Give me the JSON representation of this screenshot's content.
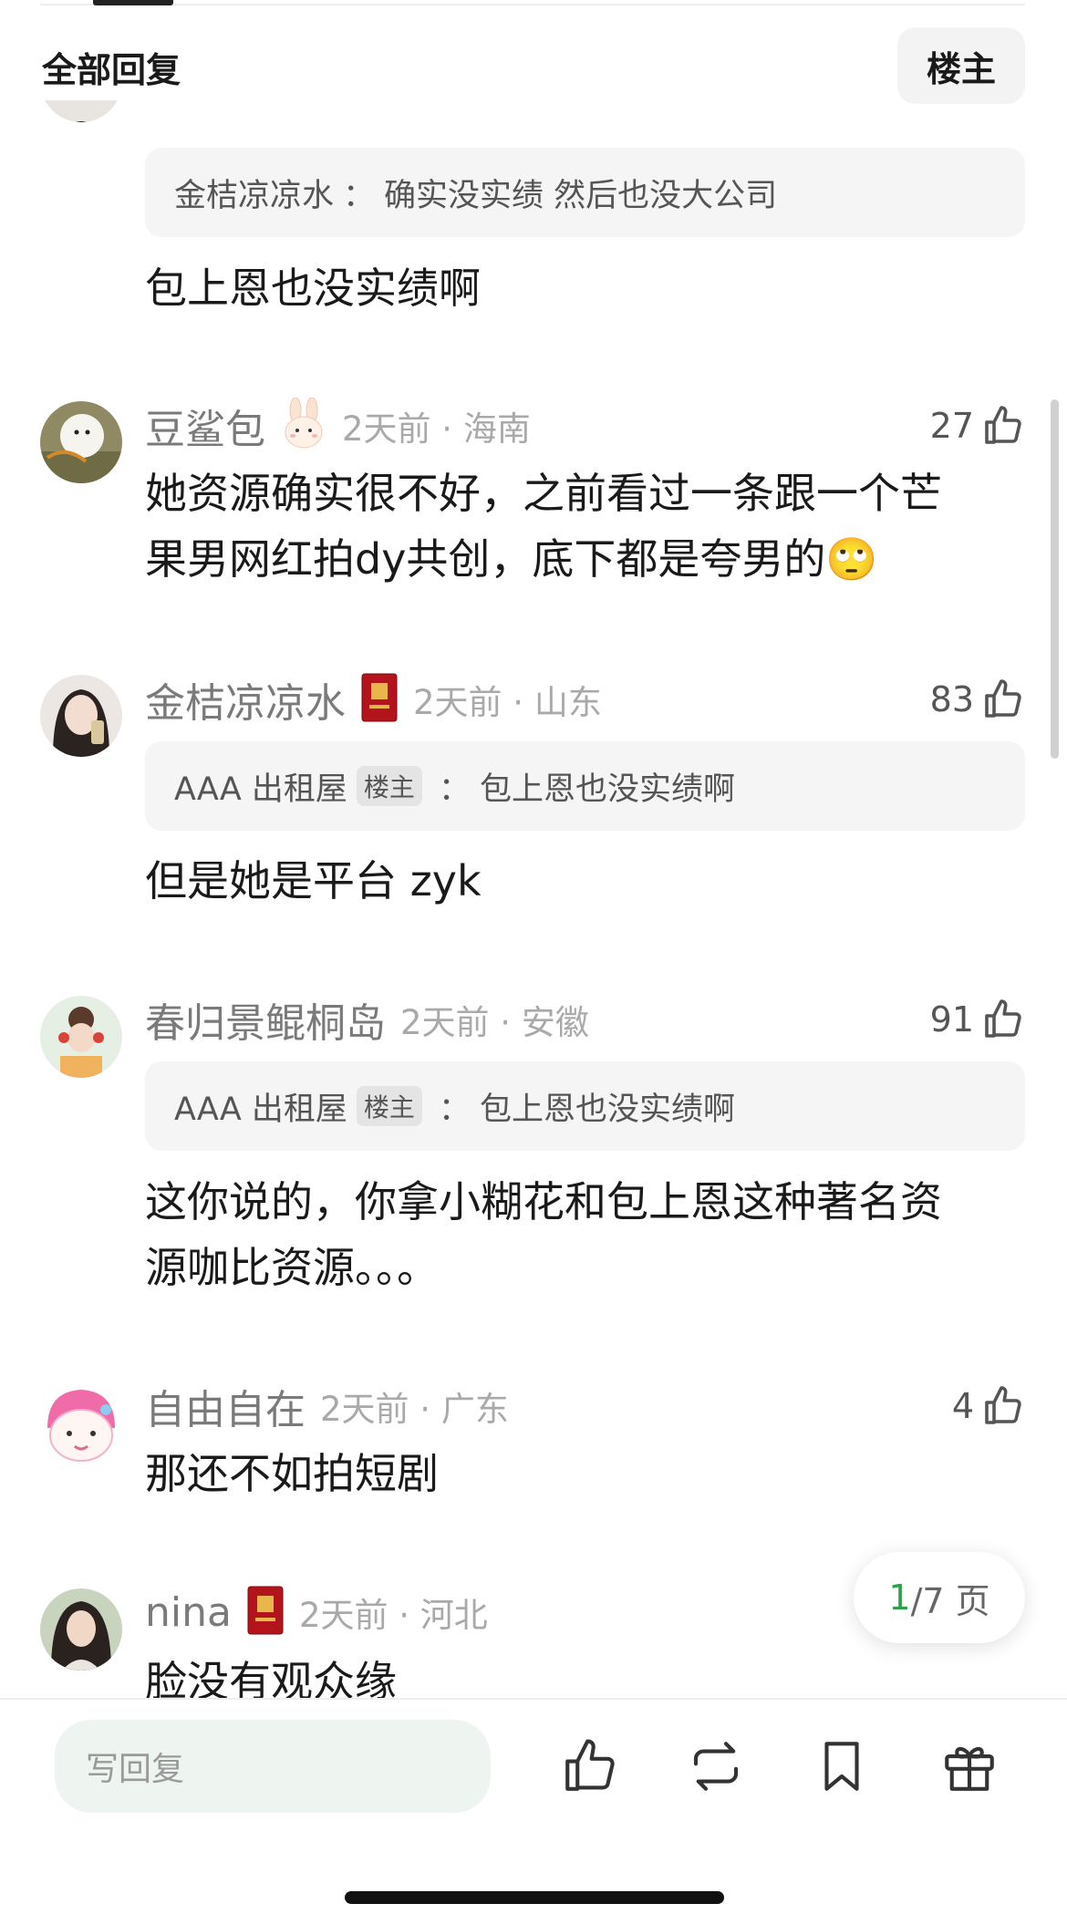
{
  "header": {
    "title": "全部回复",
    "owner_filter": "楼主"
  },
  "comments": [
    {
      "quote": {
        "author": "金桔凉凉水",
        "sep": "：",
        "text": "确实没实绩 然后也没大公司"
      },
      "text": "包上恩也没实绩啊"
    },
    {
      "username": "豆鲨包",
      "time": "2天前 · 海南",
      "likes": "27",
      "badge": "bunny-icon",
      "text_lines": [
        "她资源确实很不好，之前看过一条跟一个芒",
        "果男网红拍dy共创，底下都是夸男的🙄"
      ]
    },
    {
      "username": "金桔凉凉水",
      "time": "2天前 · 山东",
      "likes": "83",
      "badge": "red-book-badge-icon",
      "quote": {
        "author": "AAA 出租屋",
        "tag": "楼主",
        "sep": "：",
        "text": "包上恩也没实绩啊"
      },
      "text": "但是她是平台 zyk"
    },
    {
      "username": "春归景鲲桐岛",
      "time": "2天前 · 安徽",
      "likes": "91",
      "quote": {
        "author": "AAA 出租屋",
        "tag": "楼主",
        "sep": "：",
        "text": "包上恩也没实绩啊"
      },
      "text_lines": [
        "这你说的，你拿小糊花和包上恩这种著名资",
        "源咖比资源。。。"
      ]
    },
    {
      "username": "自由自在",
      "time": "2天前 · 广东",
      "likes": "4",
      "text": "那还不如拍短剧"
    },
    {
      "username": "nina",
      "time": "2天前 · 河北",
      "badge": "red-book-badge-icon",
      "text": "脸没有观众缘"
    }
  ],
  "pagination": {
    "current": "1",
    "total_label": "/7 页"
  },
  "bottom_bar": {
    "reply_placeholder": "写回复",
    "icons": [
      "thumb-up-icon",
      "repost-icon",
      "bookmark-icon",
      "gift-icon"
    ]
  }
}
